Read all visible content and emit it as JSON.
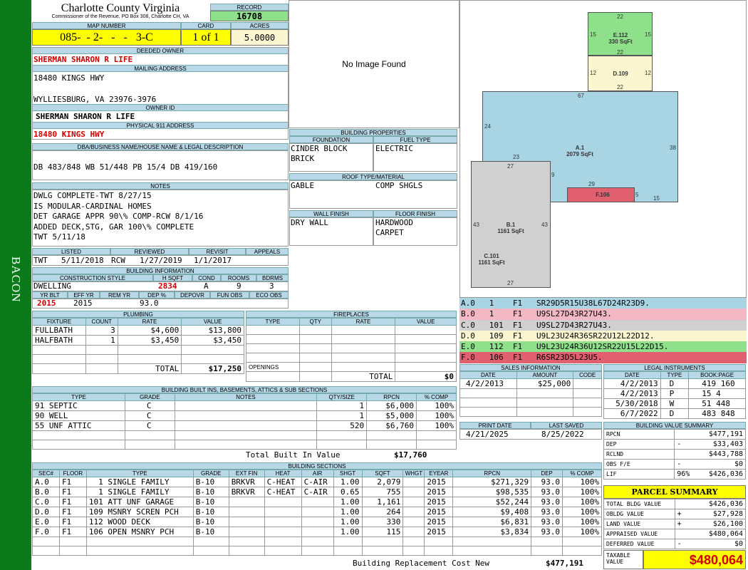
{
  "county": {
    "title": "Charlotte County Virginia",
    "subtitle": "Commissioner of the Revenue, PO Box 308, Charlotte CH, VA"
  },
  "record": {
    "label": "RECORD",
    "value": "16708"
  },
  "map": {
    "map_label": "MAP NUMBER",
    "map_number": "085-  - 2-   -   -   3-C",
    "card_label": "CARD",
    "card": "1 of 1",
    "acres_label": "ACRES",
    "acres": "5.0000"
  },
  "owner": {
    "deeded_label": "DEEDED OWNER",
    "deeded": "SHERMAN SHARON R LIFE",
    "mailing_label": "MAILING ADDRESS",
    "addr1": "18480 KINGS HWY",
    "addr2": "WYLLIESBURG, VA 23976-3976",
    "ownerid_label": "OWNER ID",
    "ownerid": "SHERMAN SHARON R LIFE",
    "phys_label": "PHYSICAL 911 ADDRESS",
    "phys": "18480 KINGS HWY"
  },
  "image": {
    "text": "No Image Found"
  },
  "dba": {
    "label": "DBA/BUSINESS NAME/HOUSE NAME & LEGAL DESCRIPTION",
    "text": "DB 483/848 WB 51/448 PB 15/4 DB 419/160"
  },
  "notes": {
    "label": "NOTES",
    "lines": [
      "DWLG COMPLETE-TWT 8/27/15",
      "IS MODULAR-CARDINAL HOMES",
      "DET GARAGE APPR 90\\% COMP-RCW 8/1/16",
      "ADDED DECK,STG, GAR 100\\% COMPLETE",
      "TWT 5/11/18"
    ]
  },
  "props": {
    "label": "BUILDING PROPERTIES",
    "foundation_label": "FOUNDATION",
    "fuel_label": "FUEL TYPE",
    "foundation1": "CINDER BLOCK",
    "foundation2": "BRICK",
    "fuel": "ELECTRIC",
    "roof_label": "ROOF TYPE/MATERIAL",
    "roof1": "GABLE",
    "roof2": "COMP SHGLS",
    "wall_label": "WALL FINISH",
    "floor_label": "FLOOR FINISH",
    "wall": "DRY WALL",
    "floor1": "HARDWOOD",
    "floor2": "CARPET"
  },
  "review": {
    "listed_label": "LISTED",
    "reviewed_label": "REVIEWED",
    "revisit_label": "REVISIT",
    "appeals_label": "APPEALS",
    "listed_by": "TWT",
    "listed": "5/11/2018",
    "reviewed_by": "RCW",
    "reviewed": "1/27/2019",
    "revisit": "1/1/2017"
  },
  "bldginfo": {
    "label": "BUILDING INFORMATION",
    "cs_label": "CONSTRUCTION STYLE",
    "hsqft_label": "H SQFT",
    "cond_label": "COND",
    "rooms_label": "ROOMS",
    "bdrms_label": "BDRMS",
    "style": "DWELLING",
    "hsqft": "2834",
    "cond": "A",
    "rooms": "9",
    "bdrms": "3",
    "yrblt_label": "YR BLT",
    "effyr_label": "EFF YR",
    "remyr_label": "REM YR",
    "dep_label": "DEP %",
    "depovr_label": "DEPOVR",
    "funobs_label": "FUN OBS",
    "ecoobs_label": "ECO OBS",
    "yrblt": "2015",
    "effyr": "2015",
    "dep": "93.0"
  },
  "plumbing": {
    "label": "PLUMBING",
    "headers": [
      "FIXTURE",
      "COUNT",
      "RATE",
      "VALUE"
    ],
    "rows": [
      [
        "FULLBATH",
        "3",
        "$4,600",
        "$13,800"
      ],
      [
        "HALFBATH",
        "1",
        "$3,450",
        "$3,450"
      ]
    ],
    "total_label": "TOTAL",
    "total": "$17,250"
  },
  "fireplaces": {
    "label": "FIREPLACES",
    "headers": [
      "TYPE",
      "QTY",
      "RATE",
      "VALUE"
    ],
    "openings": "OPENINGS",
    "total_label": "TOTAL",
    "total": "$0"
  },
  "builtins": {
    "label": "BUILDING BUILT INS, BASEMENTS, ATTICS & SUB SECTIONS",
    "headers": [
      "TYPE",
      "GRADE",
      "NOTES",
      "QTY/SIZE",
      "RPCN",
      "% COMP"
    ],
    "rows": [
      [
        "91 SEPTIC",
        "C",
        "",
        "1",
        "$6,000",
        "100%"
      ],
      [
        "90 WELL",
        "C",
        "",
        "1",
        "$5,000",
        "100%"
      ],
      [
        "55 UNF ATTIC",
        "C",
        "",
        "520",
        "$6,760",
        "100%"
      ]
    ],
    "total_label": "Total Built In Value",
    "total": "$17,760"
  },
  "sections": {
    "label": "BUILDING SECTIONS",
    "headers": [
      "SEC#",
      "FLOOR",
      "TYPE",
      "GRADE",
      "EXT FIN",
      "HEAT",
      "AIR",
      "SHGT",
      "SQFT",
      "WHGT",
      "EYEAR",
      "RPCN",
      "DEP",
      "% COMP"
    ],
    "rows": [
      [
        "A.0",
        "F1",
        "  1 SINGLE FAMILY",
        "B-10",
        "BRKVR",
        "C-HEAT",
        "C-AIR",
        "1.00",
        "2,079",
        "",
        "2015",
        "$271,329",
        "93.0",
        "100%"
      ],
      [
        "B.0",
        "F1",
        "  1 SINGLE FAMILY",
        "B-10",
        "BRKVR",
        "C-HEAT",
        "C-AIR",
        "0.65",
        "755",
        "",
        "2015",
        "$98,535",
        "93.0",
        "100%"
      ],
      [
        "C.0",
        "F1",
        "101 ATT UNF GARAGE",
        "B-10",
        "",
        "",
        "",
        "1.00",
        "1,161",
        "",
        "2015",
        "$52,244",
        "93.0",
        "100%"
      ],
      [
        "D.0",
        "F1",
        "109 MSNRY SCREN PCH",
        "B-10",
        "",
        "",
        "",
        "1.00",
        "264",
        "",
        "2015",
        "$9,408",
        "93.0",
        "100%"
      ],
      [
        "E.0",
        "F1",
        "112 WOOD DECK",
        "B-10",
        "",
        "",
        "",
        "1.00",
        "330",
        "",
        "2015",
        "$6,831",
        "93.0",
        "100%"
      ],
      [
        "F.0",
        "F1",
        "106 OPEN MSNRY PCH",
        "B-10",
        "",
        "",
        "",
        "1.00",
        "115",
        "",
        "2015",
        "$3,834",
        "93.0",
        "100%"
      ]
    ],
    "total_label": "Building Replacement Cost New",
    "total": "$477,191"
  },
  "sketch": {
    "labels": [
      {
        "id": "E.112",
        "area": "330 SqFt"
      },
      {
        "id": "D.109",
        "area": ""
      },
      {
        "id": "A.1",
        "area": "2079 SqFt"
      },
      {
        "id": "F.106",
        "area": ""
      },
      {
        "id": "B.1",
        "area": "1161 SqFt"
      },
      {
        "id": "C.101",
        "area": "1161 SqFt"
      }
    ],
    "dims": [
      "22",
      "15",
      "15",
      "22",
      "12",
      "12",
      "22",
      "67",
      "24",
      "38",
      "23",
      "27",
      "9",
      "29",
      "5",
      "15",
      "43",
      "43",
      "27"
    ]
  },
  "legend": {
    "rows": [
      {
        "text": "A.0   1    F1   SR29D5R15U38L67D24R23D9.",
        "color": "#a8d4e4"
      },
      {
        "text": "B.0   1    F1   U9SL27D43R27U43.",
        "color": "#f4b8c4"
      },
      {
        "text": "C.0   101  F1   U9SL27D43R27U43.",
        "color": "#d0d0d0"
      },
      {
        "text": "D.0   109  F1   U9L23U24R36SR22U12L22D12.",
        "color": "#fbf6d0"
      },
      {
        "text": "E.0   112  F1   U9L23U24R36U12SR22U15L22D15.",
        "color": "#8fe08a"
      },
      {
        "text": "F.0   106  F1   R6SR23D5L23U5.",
        "color": "#e06070"
      }
    ]
  },
  "sales": {
    "label": "SALES INFORMATION",
    "headers": [
      "DATE",
      "AMOUNT",
      "CODE"
    ],
    "rows": [
      [
        "4/2/2013",
        "$25,000",
        ""
      ]
    ]
  },
  "legal": {
    "label": "LEGAL INSTRUMENTS",
    "headers": [
      "DATE",
      "TYPE",
      "BOOK:PAGE"
    ],
    "rows": [
      [
        "4/2/2013",
        "D",
        "419 160"
      ],
      [
        "4/2/2013",
        "P",
        "15 4"
      ],
      [
        "5/30/2018",
        "W",
        "51 448"
      ],
      [
        "6/7/2022",
        "D",
        "483 848"
      ]
    ]
  },
  "dates": {
    "print_label": "PRINT DATE",
    "saved_label": "LAST SAVED",
    "print": "4/21/2025",
    "saved": "8/25/2022"
  },
  "valsum": {
    "label": "BUILDING VALUE SUMMARY",
    "rows": [
      [
        "RPCN",
        "",
        "$477,191"
      ],
      [
        "DEP",
        "-",
        "$33,403"
      ],
      [
        "RCLND",
        "",
        "$443,788"
      ],
      [
        "OBS F/E",
        "-",
        "$0"
      ],
      [
        "LIF",
        "96%",
        "$426,036"
      ]
    ]
  },
  "parcel": {
    "label": "PARCEL SUMMARY",
    "rows": [
      [
        "TOTAL BLDG VALUE",
        "",
        "$426,036"
      ],
      [
        "OBLDG VALUE",
        "+",
        "$27,928"
      ],
      [
        "LAND VALUE",
        "+",
        "$26,100"
      ],
      [
        "APPRAISED VALUE",
        "",
        "$480,064"
      ],
      [
        "DEFERRED VALUE",
        "-",
        "$0"
      ]
    ],
    "taxable_label1": "TAXABLE",
    "taxable_label2": "VALUE",
    "taxable": "$480,064"
  },
  "side": {
    "label": "BACON"
  }
}
